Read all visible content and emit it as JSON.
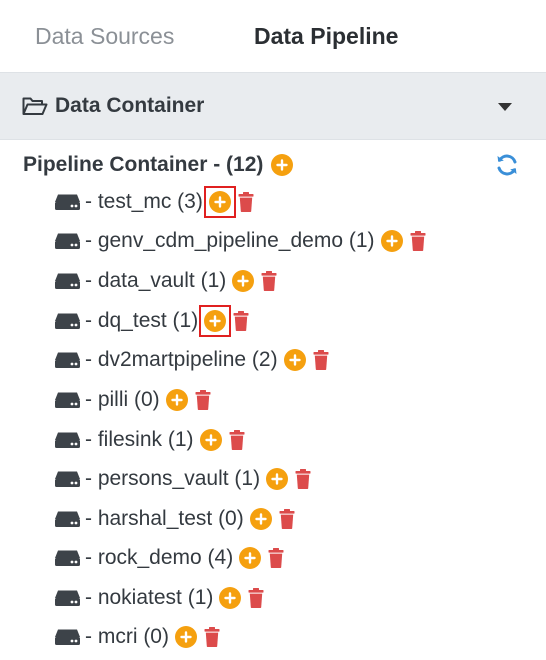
{
  "tabs": [
    {
      "label": "Data Sources",
      "active": false
    },
    {
      "label": "Data Pipeline",
      "active": true
    }
  ],
  "panel": {
    "title": "Data Container",
    "icon": "folder-open-icon",
    "collapse_icon": "caret-down-icon"
  },
  "pipeline": {
    "title": "Pipeline Container - (12)",
    "refresh_icon": "refresh-icon"
  },
  "items": [
    {
      "label": "- test_mc (3)",
      "highlighted": true
    },
    {
      "label": "- genv_cdm_pipeline_demo (1)",
      "highlighted": false
    },
    {
      "label": "- data_vault (1)",
      "highlighted": false
    },
    {
      "label": "- dq_test (1)",
      "highlighted": true
    },
    {
      "label": "- dv2martpipeline (2)",
      "highlighted": false
    },
    {
      "label": "- pilli (0)",
      "highlighted": false
    },
    {
      "label": "- filesink (1)",
      "highlighted": false
    },
    {
      "label": "- persons_vault (1)",
      "highlighted": false
    },
    {
      "label": "- harshal_test (0)",
      "highlighted": false
    },
    {
      "label": "- rock_demo (4)",
      "highlighted": false
    },
    {
      "label": "- nokiatest (1)",
      "highlighted": false
    },
    {
      "label": "- mcri (0)",
      "highlighted": false
    }
  ],
  "colors": {
    "add": "#f5a00f",
    "delete": "#dc4b4b",
    "refresh": "#3a8fd8",
    "highlight": "#e02020"
  }
}
